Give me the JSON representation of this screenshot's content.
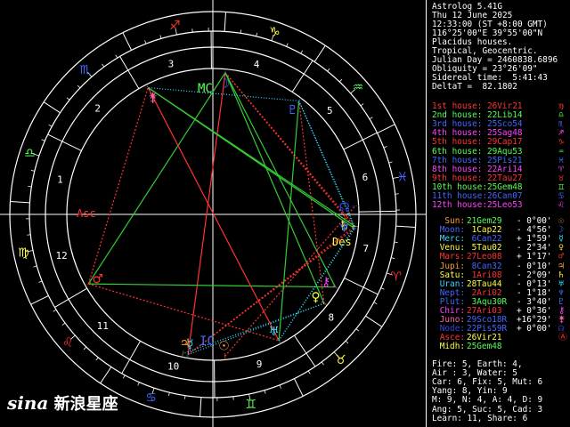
{
  "app": {
    "name": "Astrolog 5.41G",
    "date": "Thu 12 June 2025",
    "time": "12:33:00 (ST +8:00 GMT)",
    "location": "116°25'00\"E 39°55'00\"N",
    "house_system": "Placidus houses.",
    "zodiac": "Tropical, Geocentric.",
    "julian_day": "Julian Day = 2460838.6896",
    "obliquity": "Obliquity = 23°26'09\"",
    "sidereal_time": "Sidereal time:  5:41:43",
    "delta_t": "DeltaT =  82.1802"
  },
  "houses": [
    {
      "label": "1st house:",
      "value": "26Vir21",
      "color": "red",
      "glyph": "♍"
    },
    {
      "label": "2nd house:",
      "value": "22Lib14",
      "color": "lime",
      "glyph": "♎"
    },
    {
      "label": "3rd house:",
      "value": "25Sco54",
      "color": "blue",
      "glyph": "♏"
    },
    {
      "label": "4th house:",
      "value": "25Sag48",
      "color": "magenta",
      "glyph": "♐"
    },
    {
      "label": "5th house:",
      "value": "29Cap17",
      "color": "red",
      "glyph": "♑"
    },
    {
      "label": "6th house:",
      "value": "29Aqu53",
      "color": "lime",
      "glyph": "♒"
    },
    {
      "label": "7th house:",
      "value": "25Pis21",
      "color": "blue",
      "glyph": "♓"
    },
    {
      "label": "8th house:",
      "value": "22Ari14",
      "color": "magenta",
      "glyph": "♈"
    },
    {
      "label": "9th house:",
      "value": "22Tau27",
      "color": "red",
      "glyph": "♉"
    },
    {
      "label": "10th house:",
      "value": "25Gem48",
      "color": "lime",
      "glyph": "♊"
    },
    {
      "label": "11th house:",
      "value": "26Can07",
      "color": "blue",
      "glyph": "♋"
    },
    {
      "label": "12th house:",
      "value": "25Leo53",
      "color": "magenta",
      "glyph": "♌"
    }
  ],
  "planets": [
    {
      "label": "Sun:",
      "value": "21Gem29",
      "speed": "- 0°00'",
      "name_color": "orange",
      "value_color": "lime",
      "glyph": "☉",
      "glyph_color": "orange"
    },
    {
      "label": "Moon:",
      "value": " 1Cap22",
      "speed": "- 4°56'",
      "name_color": "blue",
      "value_color": "yellow",
      "glyph": "☽",
      "glyph_color": "blue"
    },
    {
      "label": "Merc:",
      "value": " 6Can22",
      "speed": "+ 1°59'",
      "name_color": "cyan",
      "value_color": "blue",
      "glyph": "☿",
      "glyph_color": "cyan"
    },
    {
      "label": "Venu:",
      "value": " 5Tau02",
      "speed": "- 2°34'",
      "name_color": "yellow",
      "value_color": "yellow",
      "glyph": "♀",
      "glyph_color": "yellow"
    },
    {
      "label": "Mars:",
      "value": "27Leo08",
      "speed": "+ 1°17'",
      "name_color": "red",
      "value_color": "red",
      "glyph": "♂",
      "glyph_color": "red"
    },
    {
      "label": "Jupi:",
      "value": " 8Can32",
      "speed": "- 0°10'",
      "name_color": "orange",
      "value_color": "blue",
      "glyph": "♃",
      "glyph_color": "orange"
    },
    {
      "label": "Satu:",
      "value": " 1Ari08",
      "speed": "- 2°09'",
      "name_color": "yellow",
      "value_color": "red",
      "glyph": "♄",
      "glyph_color": "yellow"
    },
    {
      "label": "Uran:",
      "value": "28Tau44",
      "speed": "- 0°13'",
      "name_color": "cyan",
      "value_color": "yellow",
      "glyph": "♅",
      "glyph_color": "cyan"
    },
    {
      "label": "Nept:",
      "value": " 2Ari02",
      "speed": "- 1°18'",
      "name_color": "blue",
      "value_color": "red",
      "glyph": "♆",
      "glyph_color": "blue"
    },
    {
      "label": "Plut:",
      "value": " 3Aqu30R",
      "speed": "- 3°40'",
      "name_color": "blue",
      "value_color": "lime",
      "glyph": "♇",
      "glyph_color": "blue"
    },
    {
      "label": "Chir:",
      "value": "27Ari03",
      "speed": "+ 0°36'",
      "name_color": "magenta",
      "value_color": "red",
      "glyph": "⚷",
      "glyph_color": "magenta"
    },
    {
      "label": "Juno:",
      "value": "29Sco18R",
      "speed": "+16°29'",
      "name_color": "pink",
      "value_color": "blue",
      "glyph": "⚵",
      "glyph_color": "pink"
    },
    {
      "label": "Node:",
      "value": "22Pis59R",
      "speed": "+ 0°00'",
      "name_color": "dkblue",
      "value_color": "blue",
      "glyph": "☊",
      "glyph_color": "dkblue"
    },
    {
      "label": "Asce:",
      "value": "26Vir21",
      "speed": "",
      "name_color": "red",
      "value_color": "yellow",
      "glyph": "Ⓐ",
      "glyph_color": "red"
    },
    {
      "label": "Midh:",
      "value": "25Gem48",
      "speed": "",
      "name_color": "yellow",
      "value_color": "lime",
      "glyph": "",
      "glyph_color": "yellow"
    }
  ],
  "summary": [
    "Fire: 5, Earth: 4,",
    "Air : 3, Water: 5",
    "Car: 6, Fix: 5, Mut: 6",
    "Yang: 8, Yin: 9",
    "M: 9, N: 4, A: 4, D: 9",
    "Ang: 5, Suc: 5, Cad: 3",
    "Learn: 11, Share: 6"
  ],
  "wheel": {
    "house_numbers": [
      "1",
      "2",
      "3",
      "4",
      "5",
      "6",
      "7",
      "8",
      "9",
      "10",
      "11",
      "12"
    ],
    "asc_label": "Asc",
    "des_label": "Des",
    "ic_label": "IC",
    "mc_label": "MC"
  },
  "watermark": {
    "brand": "sina",
    "text": "新浪星座"
  },
  "colors": {
    "red": "#ff3333",
    "lime": "#55ff55",
    "blue": "#4466ff",
    "magenta": "#ff44ff",
    "orange": "#ff9933",
    "yellow": "#ffff44",
    "cyan": "#33ddff",
    "green": "#33cc33",
    "dkblue": "#3344dd",
    "pink": "#ff66aa"
  }
}
